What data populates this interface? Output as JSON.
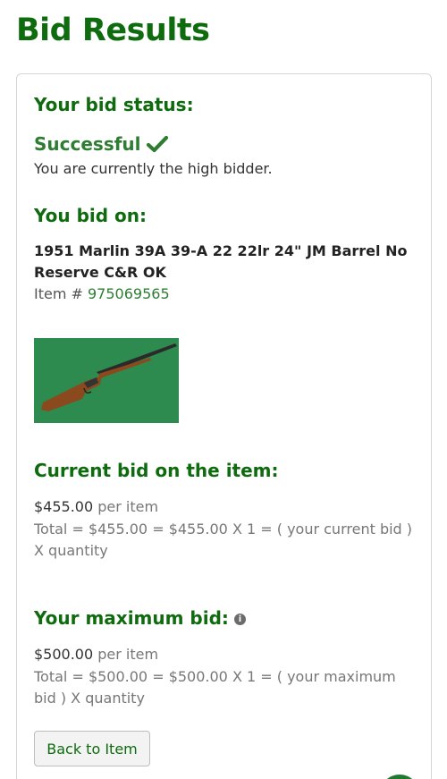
{
  "page": {
    "title": "Bid Results"
  },
  "status": {
    "heading": "Your bid status:",
    "value": "Successful",
    "message": "You are currently the high bidder."
  },
  "item": {
    "heading": "You bid on:",
    "title": "1951 Marlin 39A 39-A 22 22lr 24\" JM Barrel No Reserve C&R OK",
    "number_label": "Item # ",
    "number": "975069565"
  },
  "current_bid": {
    "heading": "Current bid on the item:",
    "amount": "$455.00",
    "per_item": "per item",
    "total": "Total = $455.00 = $455.00 X 1 = ( your current bid ) X quantity"
  },
  "max_bid": {
    "heading": "Your maximum bid:",
    "amount": "$500.00",
    "per_item": "per item",
    "total": "Total = $500.00 = $500.00 X 1 = ( your maximum bid ) X quantity"
  },
  "actions": {
    "back_label": "Back to Item"
  },
  "colors": {
    "brand_green": "#0e6b0e",
    "success_green": "#2e7d32"
  },
  "icons": {
    "status": "check-icon",
    "info": "info-icon"
  }
}
